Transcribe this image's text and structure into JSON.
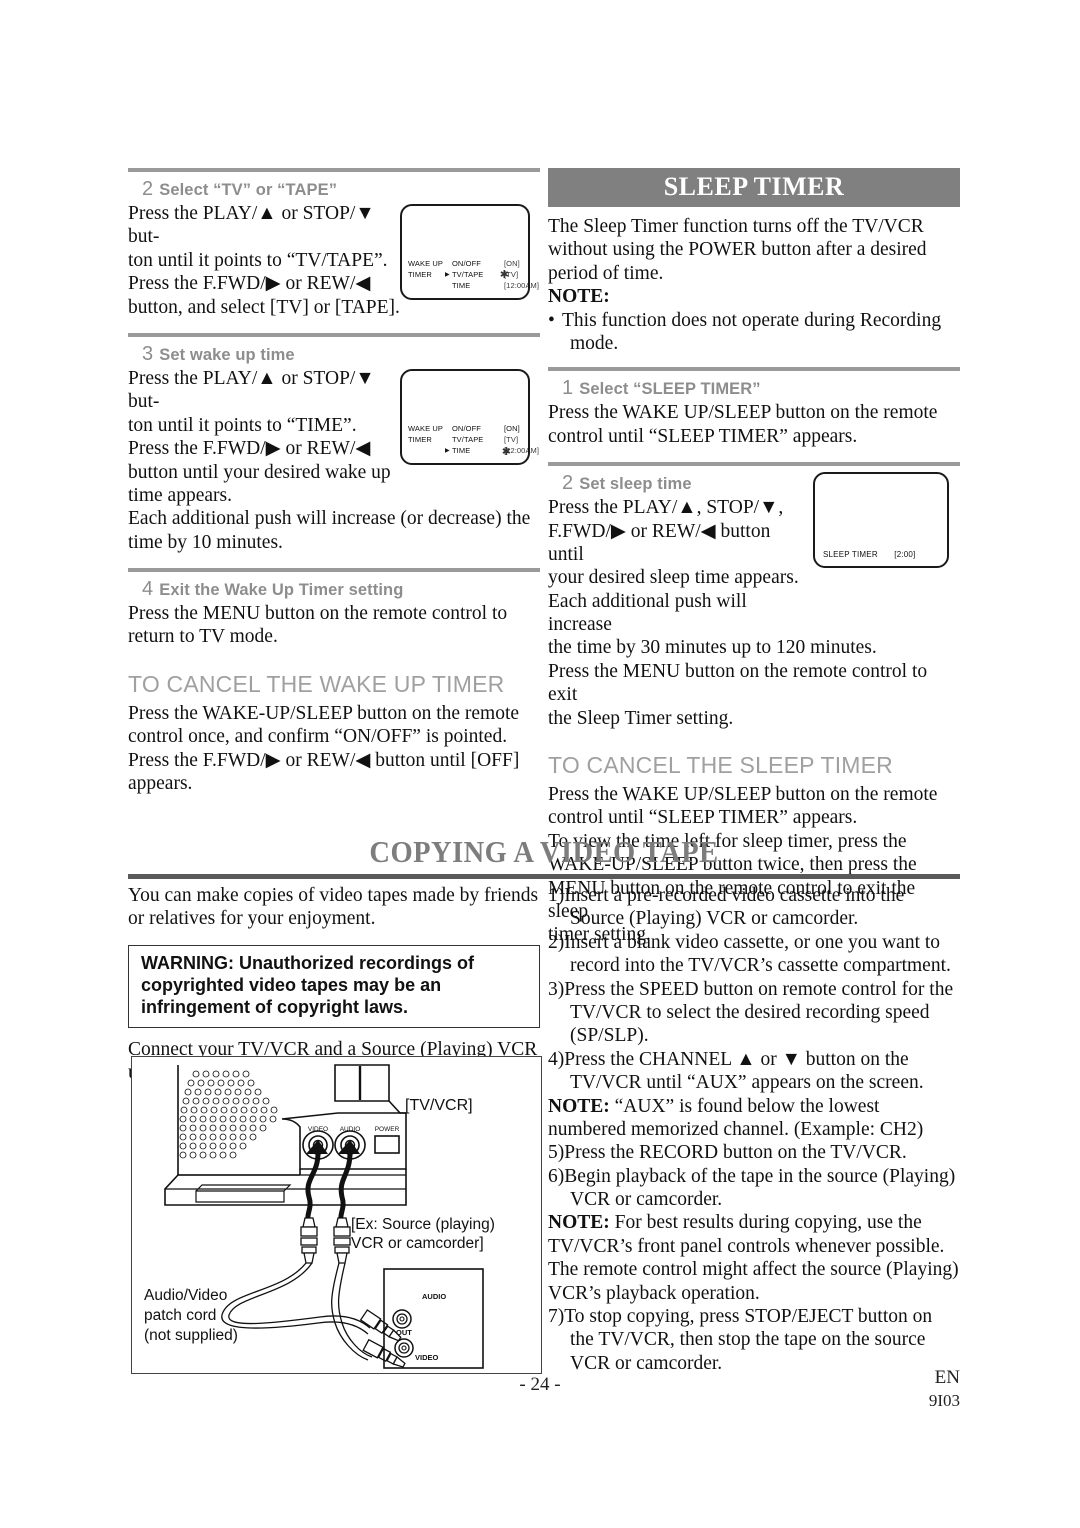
{
  "colors": {
    "bar_bg": "#808080",
    "bar_text": "#ffffff",
    "heading_gray": "#a0a0a0",
    "step_label_gray": "#8d8d8d",
    "rule_gray": "#9a9a9a",
    "chapter_title": "#7d7d7d"
  },
  "left_column": {
    "steps": [
      {
        "num": "2",
        "label": "Select “TV” or “TAPE”",
        "lines": [
          "Press the PLAY/▲ or STOP/▼ but-",
          "ton until it points to “TV/TAPE”.",
          "Press the F.FWD/▶ or REW/◀",
          "button, and select [TV] or [TAPE]."
        ],
        "osd": {
          "rows": [
            {
              "c1": "WAKE UP",
              "c2": "ON/OFF",
              "c3": "[ON]",
              "pointer": false,
              "blurry_value": true
            },
            {
              "c1": "TIMER",
              "c2": "TV/TAPE",
              "c3": "[TV]",
              "pointer": true,
              "blurry_value": false
            },
            {
              "c1": "",
              "c2": "TIME",
              "c3": "[12:00AM]",
              "pointer": false,
              "blurry_value": true
            }
          ],
          "sparkle": true
        }
      },
      {
        "num": "3",
        "label": "Set wake up time",
        "lines": [
          "Press the PLAY/▲ or STOP/▼ but-",
          "ton until it points to “TIME”.",
          "Press the F.FWD/▶ or REW/◀",
          "button until your desired wake up",
          "time appears.",
          "Each additional push will increase (or decrease) the",
          "time by 10 minutes."
        ],
        "osd": {
          "rows": [
            {
              "c1": "WAKE UP",
              "c2": "ON/OFF",
              "c3": "[ON]",
              "pointer": false,
              "blurry_value": false
            },
            {
              "c1": "TIMER",
              "c2": "TV/TAPE",
              "c3": "[TV]",
              "pointer": false,
              "blurry_value": true
            },
            {
              "c1": "",
              "c2": "TIME",
              "c3": "[12:00AM]",
              "pointer": true,
              "blurry_value": true
            }
          ],
          "sparkle": true
        }
      },
      {
        "num": "4",
        "label": "Exit the Wake Up Timer setting",
        "lines": [
          "Press the MENU button on the remote control to",
          "return to TV mode."
        ],
        "osd": null
      }
    ],
    "cancel_section": {
      "heading": "TO CANCEL THE WAKE UP TIMER",
      "lines": [
        "Press the WAKE-UP/SLEEP button on the remote",
        "control once, and confirm “ON/OFF” is pointed.",
        "Press the F.FWD/▶ or REW/◀ button until [OFF]",
        "appears."
      ]
    }
  },
  "right_column": {
    "title_bar": "SLEEP TIMER",
    "intro_lines": [
      "The Sleep Timer function turns off the TV/VCR",
      "without using the POWER button after a desired",
      "period of time."
    ],
    "note_label": "NOTE:",
    "note_lines": [
      "This function does not operate during Recording",
      "mode."
    ],
    "steps": [
      {
        "num": "1",
        "label": "Select “SLEEP TIMER”",
        "lines": [
          "Press the WAKE UP/SLEEP button on the remote",
          "control until “SLEEP TIMER” appears."
        ],
        "osd": null
      },
      {
        "num": "2",
        "label": "Set sleep time",
        "lines": [
          "Press the PLAY/▲, STOP/▼,",
          "F.FWD/▶ or REW/◀ button until",
          "your desired sleep time appears.",
          "Each additional push will increase",
          "the time by 30 minutes up to 120 minutes.",
          "Press the MENU button on the remote control to exit",
          "the Sleep Timer setting."
        ],
        "osd": {
          "label": "SLEEP TIMER",
          "value": "[2:00]"
        }
      }
    ],
    "cancel_section": {
      "heading": "TO CANCEL THE SLEEP TIMER",
      "lines": [
        "Press the WAKE UP/SLEEP button on the remote",
        "control until “SLEEP TIMER” appears.",
        "To view the time left for sleep timer, press the",
        "WAKE-UP/SLEEP button twice, then press the",
        "MENU button on the remote control to exit the sleep",
        "timer setting."
      ]
    }
  },
  "chapter": {
    "title": "COPYING A VIDEO TAPE"
  },
  "copy_left": {
    "intro_lines": [
      "You can make copies of video tapes made by friends",
      "or relatives for your enjoyment."
    ],
    "warning_lines": [
      "WARNING: Unauthorized recordings of",
      "copyrighted video tapes may be an",
      "infringement of copyright laws."
    ],
    "connect_lines": [
      "Connect your TV/VCR and a Source (Playing) VCR",
      "using the following diagram."
    ]
  },
  "copy_right": {
    "items": [
      {
        "type": "num",
        "text": "1)Insert a pre-recorded video cassette into the Source (Playing) VCR or camcorder."
      },
      {
        "type": "num",
        "text": "2)Insert a blank video cassette, or one you want to record into the TV/VCR’s cassette compartment."
      },
      {
        "type": "num",
        "text": "3)Press the SPEED button on remote control for the TV/VCR to select the desired recording speed (SP/SLP)."
      },
      {
        "type": "num",
        "text": "4)Press the CHANNEL ▲ or ▼ button on the TV/VCR until “AUX” appears on the screen."
      },
      {
        "type": "note",
        "bold": "NOTE:",
        "text": " “AUX” is found below the lowest numbered memorized channel. (Example: CH2)"
      },
      {
        "type": "num",
        "text": "5)Press the RECORD button on the TV/VCR."
      },
      {
        "type": "num",
        "text": "6)Begin playback of the tape in the source (Playing) VCR or camcorder."
      },
      {
        "type": "note",
        "bold": "NOTE:",
        "text": " For best results during copying, use the TV/VCR’s front panel controls whenever possible. The remote control might affect the source (Playing) VCR’s playback operation."
      },
      {
        "type": "num",
        "text": "7)To stop copying, press STOP/EJECT button on the TV/VCR, then stop the tape on the source VCR or camcorder."
      }
    ]
  },
  "diagram": {
    "tvvcr_label": "[TV/VCR]",
    "source_label_line1": "[Ex: Source (playing)",
    "source_label_line2": "VCR or camcorder]",
    "patchcord_line1": "Audio/Video",
    "patchcord_line2": "patch cord",
    "patchcord_line3": "(not supplied)",
    "jack_video": "VIDEO",
    "jack_audio": "AUDIO",
    "jack_power": "POWER",
    "src_audio": "AUDIO",
    "src_out": "OUT",
    "src_video": "VIDEO"
  },
  "footer": {
    "page_number": "- 24 -",
    "lang": "EN",
    "code": "9I03"
  }
}
